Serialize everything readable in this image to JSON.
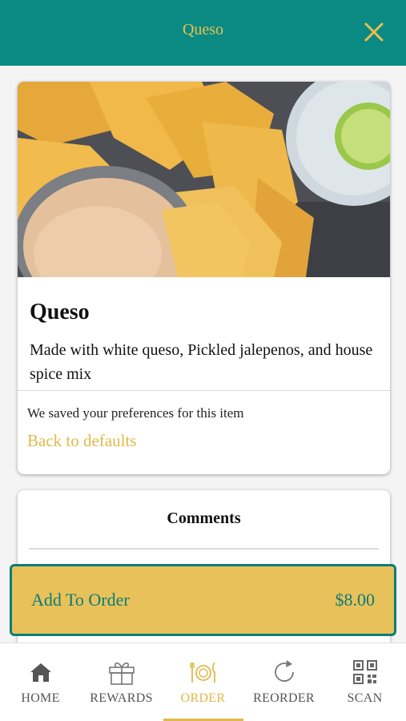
{
  "header": {
    "title": "Queso",
    "close_icon": "close-icon"
  },
  "item": {
    "image": "queso-with-tortilla-chips-photo",
    "title": "Queso",
    "description": "Made with white queso, Pickled jalepenos, and house spice mix"
  },
  "preferences": {
    "saved_text": "We saved your preferences for this item",
    "back_link": "Back to defaults"
  },
  "comments": {
    "title": "Comments"
  },
  "order_button": {
    "label": "Add To Order",
    "price": "$8.00"
  },
  "tabs": [
    {
      "label": "HOME",
      "icon": "home-icon"
    },
    {
      "label": "REWARDS",
      "icon": "gift-icon"
    },
    {
      "label": "ORDER",
      "icon": "plate-cutlery-icon",
      "active": true
    },
    {
      "label": "REORDER",
      "icon": "refresh-icon"
    },
    {
      "label": "SCAN",
      "icon": "qr-code-icon"
    }
  ],
  "colors": {
    "header": "#0b8a84",
    "accent": "#e2b84a",
    "button": "#e8c15a",
    "teal_text": "#0b7d77"
  }
}
